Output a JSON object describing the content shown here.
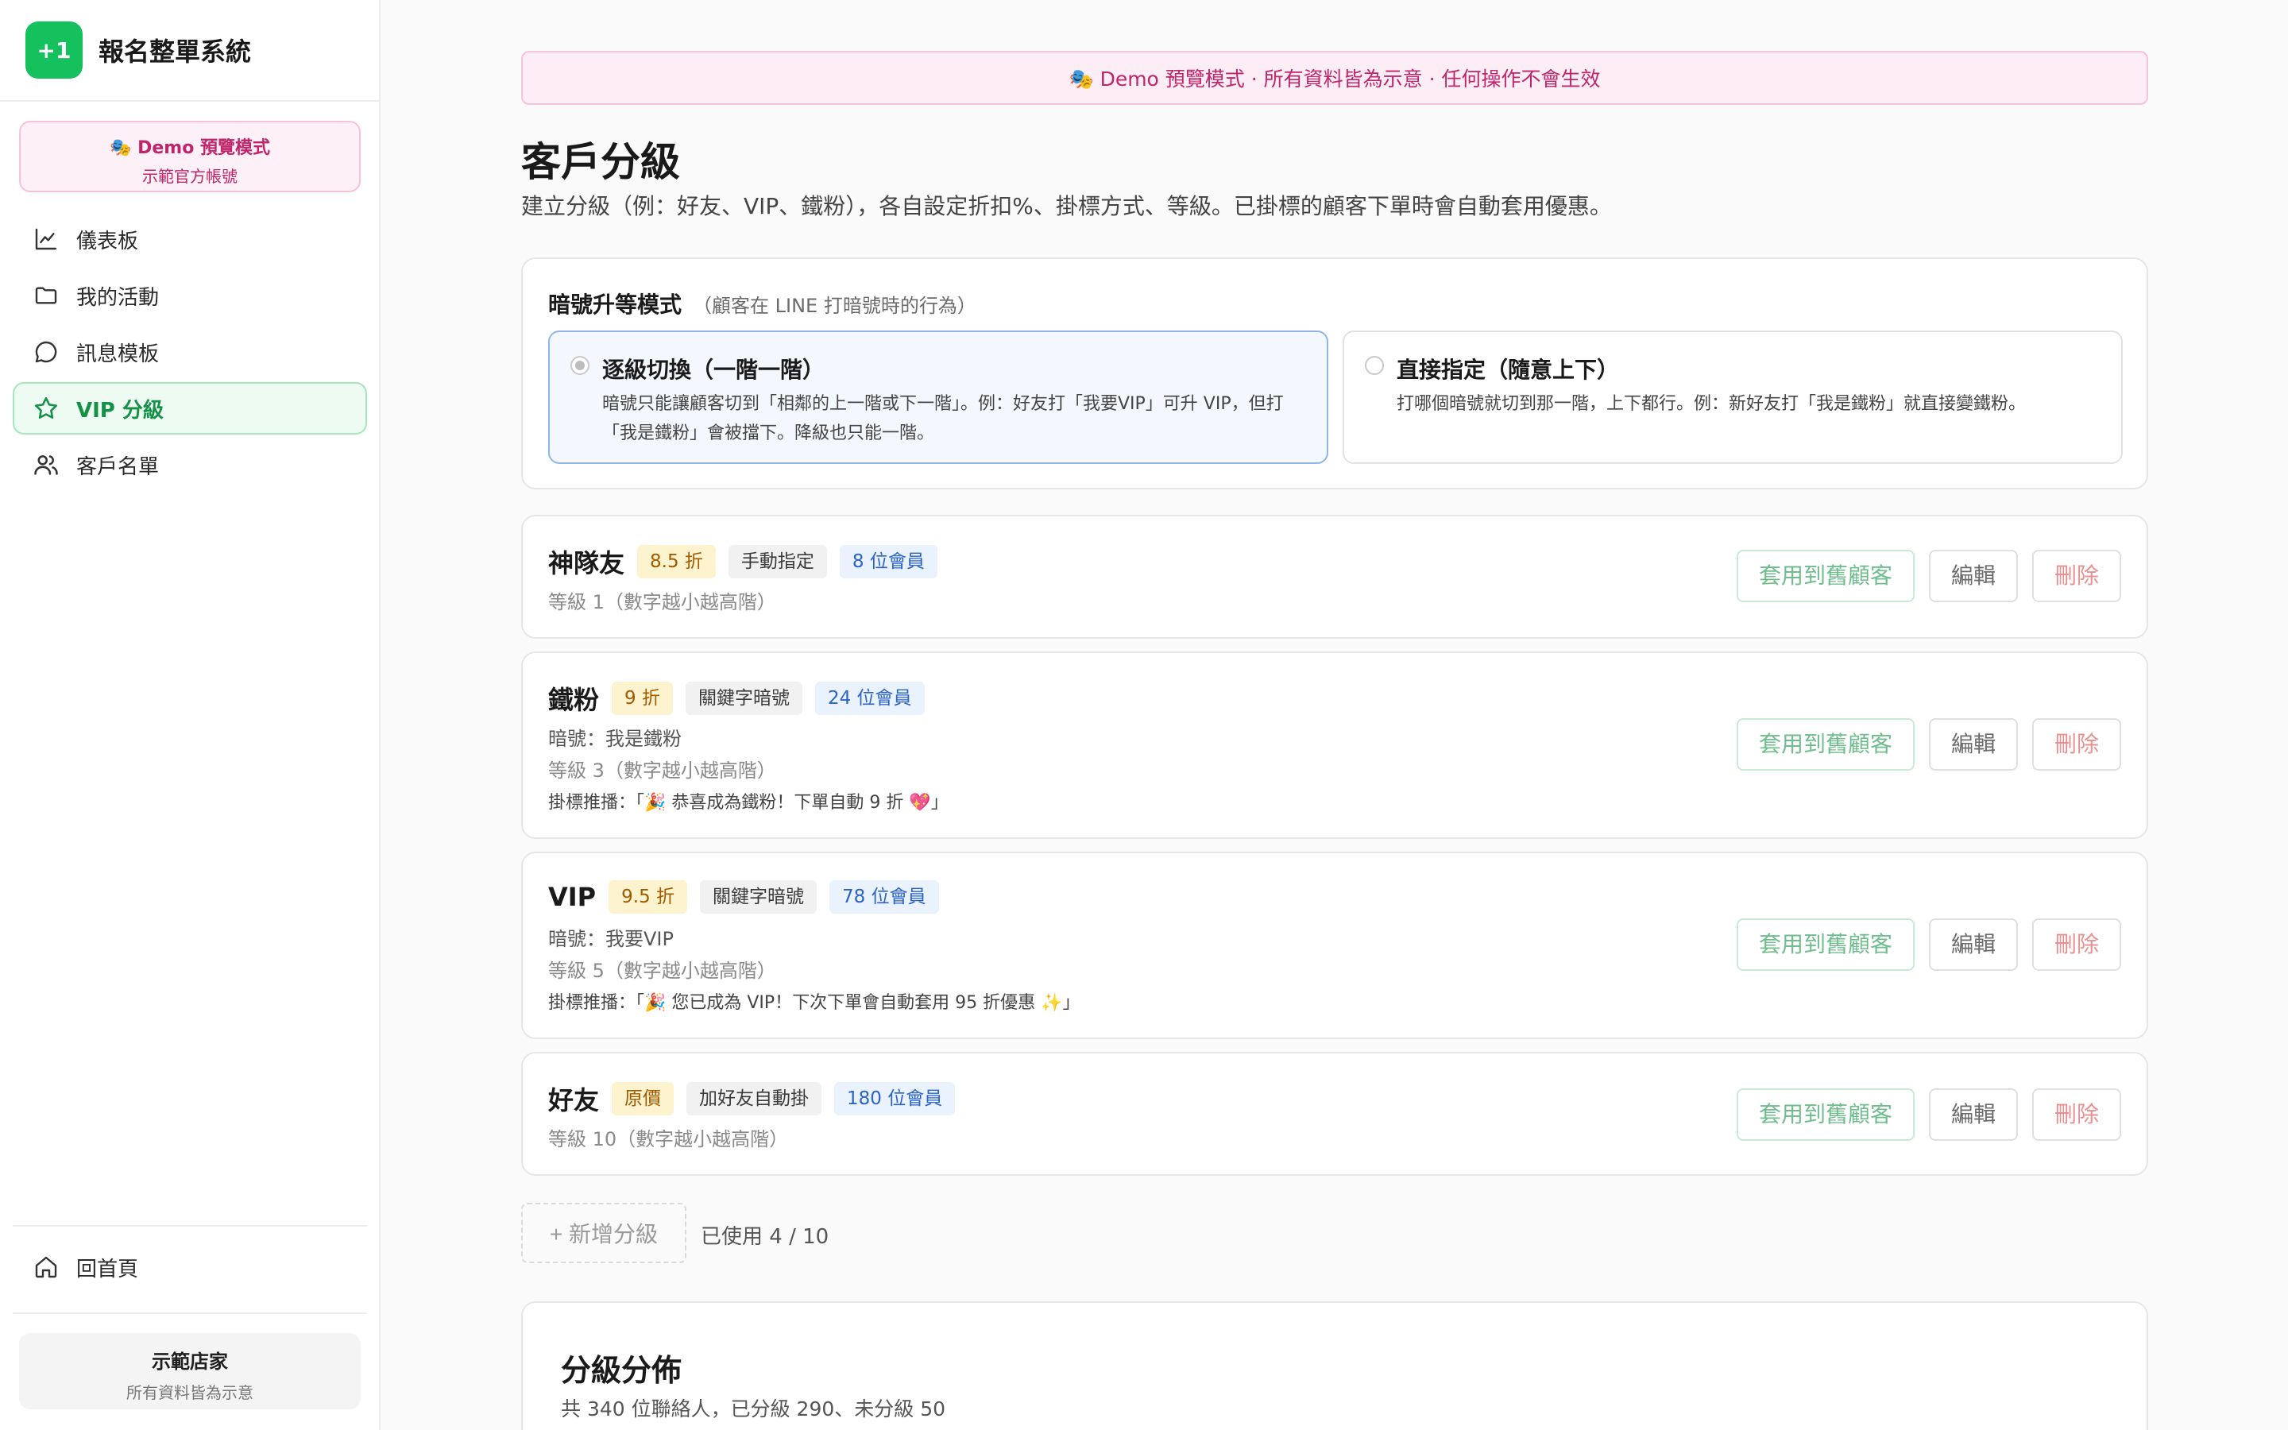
{
  "brand": {
    "logo": "+1",
    "name": "報名整單系統"
  },
  "sidebar": {
    "demo": {
      "title": "🎭 Demo 預覽模式",
      "subtitle": "示範官方帳號"
    },
    "items": [
      {
        "label": "儀表板",
        "icon": "chart-line-icon"
      },
      {
        "label": "我的活動",
        "icon": "folder-icon"
      },
      {
        "label": "訊息模板",
        "icon": "chat-bubble-icon"
      },
      {
        "label": "VIP 分級",
        "icon": "star-icon",
        "active": true
      },
      {
        "label": "客戶名單",
        "icon": "users-icon"
      }
    ],
    "home": {
      "label": "回首頁",
      "icon": "home-icon"
    },
    "store": {
      "title": "示範店家",
      "subtitle": "所有資料皆為示意"
    }
  },
  "banner": "🎭 Demo 預覽模式 · 所有資料皆為示意 · 任何操作不會生效",
  "page": {
    "title": "客戶分級",
    "desc": "建立分級（例：好友、VIP、鐵粉），各自設定折扣%、掛標方式、等級。已掛標的顧客下單時會自動套用優惠。"
  },
  "mode": {
    "title": "暗號升等模式",
    "subtitle": "（顧客在 LINE 打暗號時的行為）",
    "options": [
      {
        "title": "逐級切換（一階一階）",
        "desc": "暗號只能讓顧客切到「相鄰的上一階或下一階」。例：好友打「我要VIP」可升 VIP，但打「我是鐵粉」會被擋下。降級也只能一階。",
        "selected": true
      },
      {
        "title": "直接指定（隨意上下）",
        "desc": "打哪個暗號就切到那一階，上下都行。例：新好友打「我是鐵粉」就直接變鐵粉。",
        "selected": false
      }
    ]
  },
  "tiers": [
    {
      "name": "神隊友",
      "discount": "8.5 折",
      "mode": "手動指定",
      "members": "8 位會員",
      "level": "等級 1（數字越小越高階）"
    },
    {
      "name": "鐵粉",
      "discount": "9 折",
      "mode": "關鍵字暗號",
      "members": "24 位會員",
      "code": "暗號：我是鐵粉",
      "level": "等級 3（數字越小越高階）",
      "broadcast": "掛標推播：「🎉 恭喜成為鐵粉！下單自動 9 折 💖」"
    },
    {
      "name": "VIP",
      "discount": "9.5 折",
      "mode": "關鍵字暗號",
      "members": "78 位會員",
      "code": "暗號：我要VIP",
      "level": "等級 5（數字越小越高階）",
      "broadcast": "掛標推播：「🎉 您已成為 VIP！下次下單會自動套用 95 折優惠 ✨」"
    },
    {
      "name": "好友",
      "discount": "原價",
      "mode": "加好友自動掛",
      "members": "180 位會員",
      "level": "等級 10（數字越小越高階）"
    }
  ],
  "buttons": {
    "apply": "套用到舊顧客",
    "edit": "編輯",
    "delete": "刪除"
  },
  "add": {
    "label": "+ 新增分級",
    "used": "已使用 4 / 10"
  },
  "distribution": {
    "title": "分級分佈",
    "summary": "共 340 位聯絡人，已分級 290、未分級 50"
  }
}
